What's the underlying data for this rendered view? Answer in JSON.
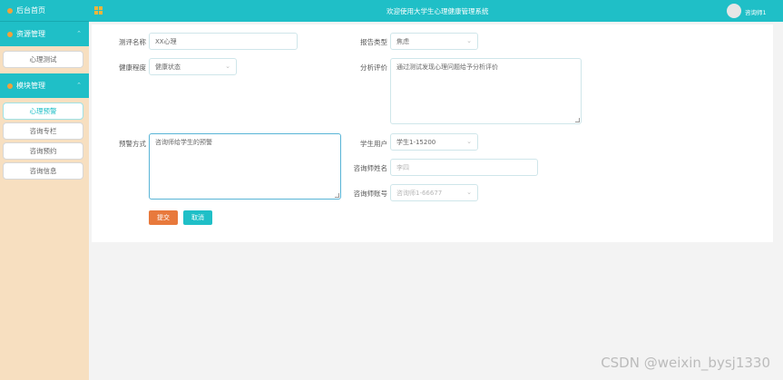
{
  "sidebar": {
    "home_label": "后台首页",
    "groups": [
      {
        "label": "资源管理",
        "items": [
          {
            "label": "心理测试"
          }
        ]
      },
      {
        "label": "模块管理",
        "items": [
          {
            "label": "心理预警"
          },
          {
            "label": "咨询专栏"
          },
          {
            "label": "咨询预约"
          },
          {
            "label": "咨询信息"
          }
        ]
      }
    ]
  },
  "topbar": {
    "title": "欢迎使用大学生心理健康管理系统",
    "user": "咨询师1"
  },
  "form": {
    "test_name": {
      "label": "测评名称",
      "value": "XX心理"
    },
    "report_type": {
      "label": "报告类型",
      "value": "焦虑"
    },
    "health_level": {
      "label": "健康程度",
      "value": "健康状态"
    },
    "analysis": {
      "label": "分析评价",
      "value": "通过测试发现心理问题给予分析评价"
    },
    "intervention": {
      "label": "预警方式",
      "value": "咨询师给学生的预警"
    },
    "student": {
      "label": "学生用户",
      "value": "学生1-15200"
    },
    "counselor_name": {
      "label": "咨询师姓名",
      "placeholder": "李四"
    },
    "counselor_account": {
      "label": "咨询师账号",
      "value": "咨询师1-66677"
    },
    "submit_label": "提交",
    "cancel_label": "取消"
  },
  "watermark": "CSDN @weixin_bysj1330",
  "colors": {
    "teal": "#1fbfc7",
    "sidebar_bg": "#f7dfc0",
    "submit": "#e8793c",
    "accent_dot": "#f2a23a"
  }
}
